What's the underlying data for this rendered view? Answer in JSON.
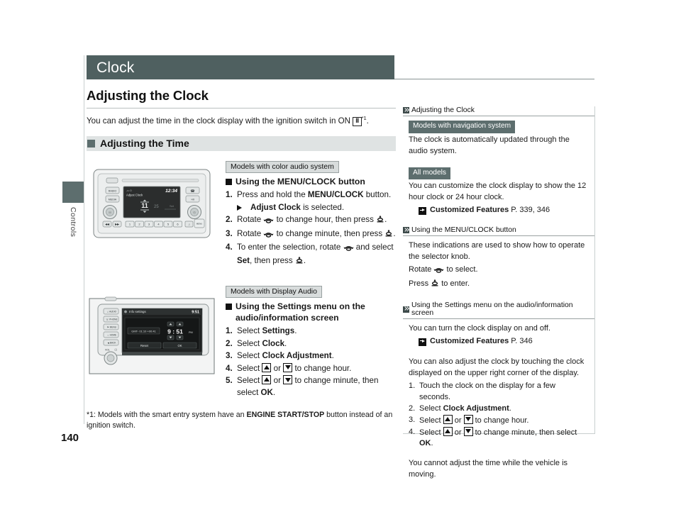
{
  "document": {
    "page_number": "140",
    "section_tab": "Controls",
    "chapter_title": "Clock"
  },
  "main": {
    "heading": "Adjusting the Clock",
    "intro_before_key": "You can adjust the time in the clock display with the ignition switch in ON ",
    "ignition_key": "II",
    "intro_footnote_marker": "*1",
    "intro_after_key": ".",
    "band_title": "Adjusting the Time",
    "sections": [
      {
        "model_tag": "Models with color audio system",
        "sub_heading": "Using the MENU/CLOCK button",
        "figure": {
          "name": "color-audio-head-unit",
          "display_header_left": "Adjust Clock",
          "display_header_right": "12:34",
          "display_value": "11",
          "buttons_left": [
            "RADIO",
            "MEDIA"
          ],
          "presets": [
            "1",
            "2",
            "3",
            "4",
            "5",
            "6"
          ]
        },
        "steps": [
          {
            "num": "1.",
            "parts": [
              {
                "t": "Press and hold the ",
                "b": false
              },
              {
                "t": "MENU/CLOCK",
                "b": true
              },
              {
                "t": " button.",
                "b": false
              }
            ]
          },
          {
            "num": "2.",
            "parts": [
              {
                "t": "Rotate ",
                "b": false
              },
              {
                "t": "[rotate]",
                "b": false
              },
              {
                "t": " to change hour, then press ",
                "b": false
              },
              {
                "t": "[press]",
                "b": false
              },
              {
                "t": ".",
                "b": false
              }
            ]
          },
          {
            "num": "3.",
            "parts": [
              {
                "t": "Rotate ",
                "b": false
              },
              {
                "t": "[rotate]",
                "b": false
              },
              {
                "t": " to change minute, then press ",
                "b": false
              },
              {
                "t": "[press]",
                "b": false
              },
              {
                "t": ".",
                "b": false
              }
            ]
          },
          {
            "num": "4.",
            "parts": [
              {
                "t": "To enter the selection, rotate ",
                "b": false
              },
              {
                "t": "[rotate]",
                "b": false
              },
              {
                "t": " and select ",
                "b": false
              },
              {
                "t": "Set",
                "b": true
              },
              {
                "t": ", then press ",
                "b": false
              },
              {
                "t": "[press]",
                "b": false
              },
              {
                "t": ".",
                "b": false
              }
            ]
          }
        ],
        "arrow_note_before": "",
        "arrow_note_bold": "Adjust Clock",
        "arrow_note_after": " is selected."
      },
      {
        "model_tag": "Models with Display Audio",
        "sub_heading": "Using the Settings menu on the audio/information screen",
        "figure": {
          "name": "display-audio-unit",
          "screen_title": "Info settings",
          "screen_clock": "9:51",
          "gmt_label": "GMT- 01:10 +00:41",
          "time_value": "9 : 51",
          "time_meridiem": "PM",
          "button_reset": "Reset",
          "button_ok": "OK",
          "vol_label": "VOL"
        },
        "steps": [
          {
            "num": "1.",
            "parts": [
              {
                "t": "Select ",
                "b": false
              },
              {
                "t": "Settings",
                "b": true
              },
              {
                "t": ".",
                "b": false
              }
            ]
          },
          {
            "num": "2.",
            "parts": [
              {
                "t": "Select ",
                "b": false
              },
              {
                "t": "Clock",
                "b": true
              },
              {
                "t": ".",
                "b": false
              }
            ]
          },
          {
            "num": "3.",
            "parts": [
              {
                "t": "Select ",
                "b": false
              },
              {
                "t": "Clock Adjustment",
                "b": true
              },
              {
                "t": ".",
                "b": false
              }
            ]
          },
          {
            "num": "4.",
            "parts": [
              {
                "t": "Select ",
                "b": false
              },
              {
                "t": "[up]",
                "b": false
              },
              {
                "t": " or ",
                "b": false
              },
              {
                "t": "[down]",
                "b": false
              },
              {
                "t": " to change hour.",
                "b": false
              }
            ]
          },
          {
            "num": "5.",
            "parts": [
              {
                "t": "Select ",
                "b": false
              },
              {
                "t": "[up]",
                "b": false
              },
              {
                "t": " or ",
                "b": false
              },
              {
                "t": "[down]",
                "b": false
              },
              {
                "t": " to change minute, then select ",
                "b": false
              },
              {
                "t": "OK",
                "b": true
              },
              {
                "t": ".",
                "b": false
              }
            ]
          }
        ]
      }
    ],
    "footnote": {
      "before": "*1: Models with the smart entry system have an ",
      "bold": "ENGINE START/STOP",
      "after": " button instead of an ignition switch."
    }
  },
  "sidebar": {
    "blocks": [
      {
        "header": "Adjusting the Clock",
        "items": [
          {
            "kind": "tag",
            "text": "Models with navigation system"
          },
          {
            "kind": "p",
            "text": "The clock is automatically updated through the audio system."
          },
          {
            "kind": "gap"
          },
          {
            "kind": "tag",
            "text": "All models"
          },
          {
            "kind": "p",
            "text": "You can customize the clock display to show the 12 hour clock or 24 hour clock."
          },
          {
            "kind": "ref",
            "bold": "Customized Features",
            "rest": "P. 339, 346"
          }
        ]
      },
      {
        "header": "Using the MENU/CLOCK button",
        "items": [
          {
            "kind": "p",
            "text": "These indications are used to show how to operate the selector knob."
          },
          {
            "kind": "p_rot",
            "before": "Rotate ",
            "after": " to select."
          },
          {
            "kind": "p_press",
            "before": "Press ",
            "after": " to enter."
          }
        ]
      },
      {
        "header": "Using the Settings menu on the audio/information screen",
        "items": [
          {
            "kind": "p",
            "text": "You can turn the clock display on and off."
          },
          {
            "kind": "ref",
            "bold": "Customized Features",
            "rest": "P. 346"
          },
          {
            "kind": "gap"
          },
          {
            "kind": "p",
            "text": "You can also adjust the clock by touching the clock displayed on the upper right corner of the display."
          },
          {
            "kind": "olist",
            "items": [
              {
                "n": "1.",
                "parts": [
                  {
                    "t": "Touch the clock on the display for a few seconds.",
                    "b": false
                  }
                ]
              },
              {
                "n": "2.",
                "parts": [
                  {
                    "t": "Select ",
                    "b": false
                  },
                  {
                    "t": "Clock Adjustment",
                    "b": true
                  },
                  {
                    "t": ".",
                    "b": false
                  }
                ]
              },
              {
                "n": "3.",
                "parts": [
                  {
                    "t": "Select ",
                    "b": false
                  },
                  {
                    "t": "[up]",
                    "b": false
                  },
                  {
                    "t": " or ",
                    "b": false
                  },
                  {
                    "t": "[down]",
                    "b": false
                  },
                  {
                    "t": " to change hour.",
                    "b": false
                  }
                ]
              },
              {
                "n": "4.",
                "parts": [
                  {
                    "t": "Select ",
                    "b": false
                  },
                  {
                    "t": "[up]",
                    "b": false
                  },
                  {
                    "t": " or ",
                    "b": false
                  },
                  {
                    "t": "[down]",
                    "b": false
                  },
                  {
                    "t": " to change minute, then select ",
                    "b": false
                  },
                  {
                    "t": "OK",
                    "b": true
                  },
                  {
                    "t": ".",
                    "b": false
                  }
                ]
              }
            ]
          },
          {
            "kind": "gap"
          },
          {
            "kind": "p",
            "text": "You cannot adjust the time while the vehicle is moving."
          }
        ]
      }
    ]
  },
  "colors": {
    "header_bar": "#4f6060",
    "band": "#dfe3e3",
    "tag_dark": "#5d6e6e",
    "rule": "#c9cfcf"
  }
}
